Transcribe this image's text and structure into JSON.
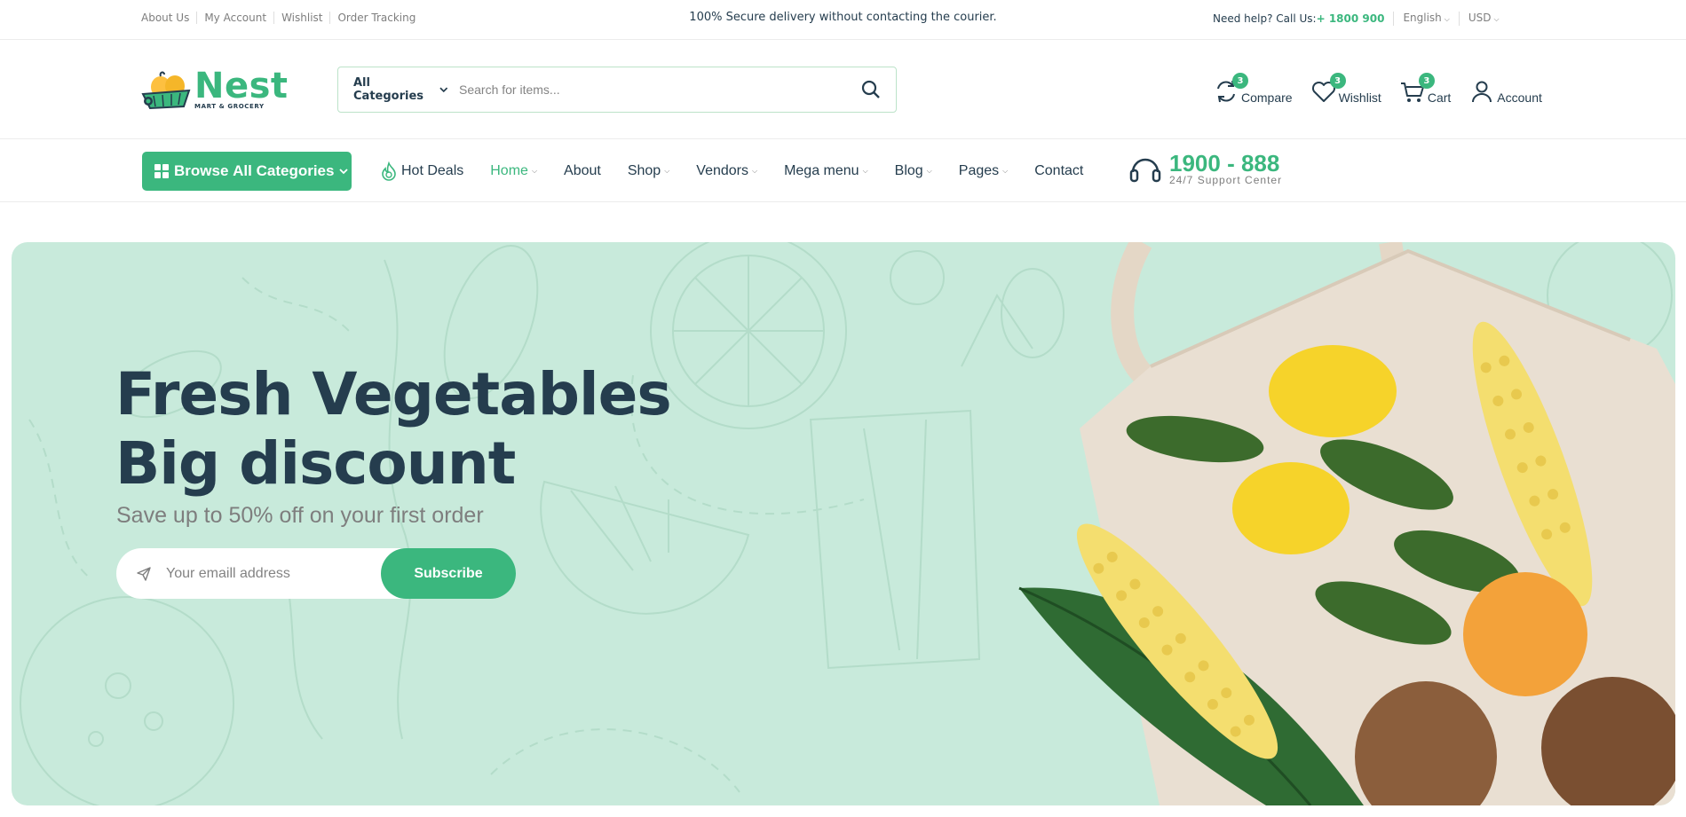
{
  "topbar": {
    "links": [
      "About Us",
      "My Account",
      "Wishlist",
      "Order Tracking"
    ],
    "message": "100% Secure delivery without contacting the courier.",
    "help_label": "Need help? Call Us:",
    "phone": "+ 1800 900",
    "language": "English",
    "currency": "USD"
  },
  "header": {
    "logo_name": "Nest",
    "logo_sub": "MART & GROCERY",
    "search": {
      "category": "All Categories",
      "placeholder": "Search for items..."
    },
    "actions": [
      {
        "label": "Compare",
        "count": "3",
        "icon": "compare-icon"
      },
      {
        "label": "Wishlist",
        "count": "3",
        "icon": "heart-icon"
      },
      {
        "label": "Cart",
        "count": "3",
        "icon": "cart-icon"
      },
      {
        "label": "Account",
        "icon": "user-icon"
      }
    ]
  },
  "nav": {
    "browse_label": "Browse",
    "browse_label2": "All Categories",
    "items": [
      {
        "label": "Hot Deals",
        "icon": "flame-icon"
      },
      {
        "label": "Home",
        "dropdown": true,
        "active": true
      },
      {
        "label": "About"
      },
      {
        "label": "Shop",
        "dropdown": true
      },
      {
        "label": "Vendors",
        "dropdown": true
      },
      {
        "label": "Mega menu",
        "dropdown": true
      },
      {
        "label": "Blog",
        "dropdown": true
      },
      {
        "label": "Pages",
        "dropdown": true
      },
      {
        "label": "Contact"
      }
    ],
    "support_number": "1900 - 888",
    "support_label": "24/7 Support Center"
  },
  "hero": {
    "title_line1": "Fresh Vegetables",
    "title_line2": "Big discount",
    "subtitle": "Save up to 50% off on your first order",
    "email_placeholder": "Your emaill address",
    "subscribe_label": "Subscribe"
  },
  "colors": {
    "brand": "#3BB77E",
    "heading": "#253D4E",
    "hero_bg": "#C8EADB",
    "muted": "#7E7E7E"
  }
}
